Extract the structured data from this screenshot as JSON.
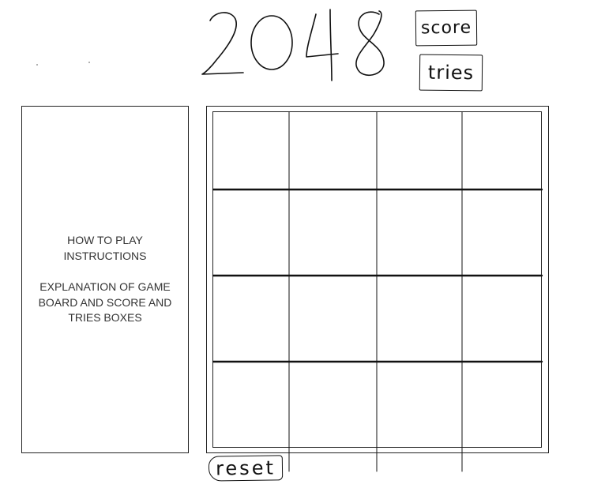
{
  "header": {
    "title": "2048",
    "score_label": "score",
    "tries_label": "tries"
  },
  "instructions": {
    "lines_block1": "HOW TO PLAY INSTRUCTIONS",
    "lines_block2": "EXPLANATION OF GAME BOARD AND SCORE AND TRIES BOXES"
  },
  "board": {
    "rows": 4,
    "cols": 4,
    "tiles": [
      [
        "",
        "",
        "",
        ""
      ],
      [
        "",
        "",
        "",
        ""
      ],
      [
        "",
        "",
        "",
        ""
      ],
      [
        "",
        "",
        "",
        ""
      ]
    ]
  },
  "controls": {
    "reset_label": "reset"
  },
  "colors": {
    "ink": "#111111",
    "text": "#333333",
    "background": "#ffffff"
  }
}
